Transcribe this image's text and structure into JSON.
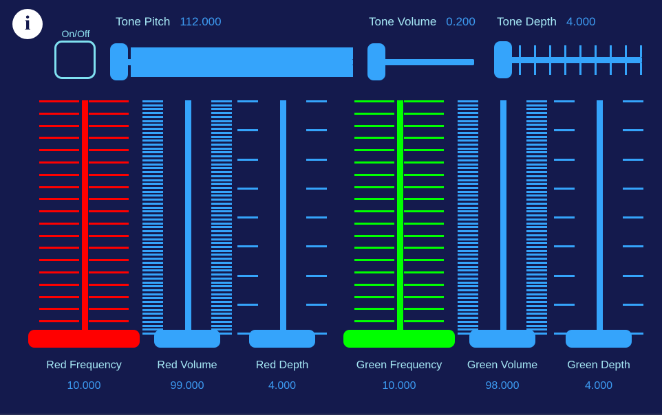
{
  "app": {
    "background": "#141a4d",
    "accent_blue": "#35a4fb",
    "label_color": "#a7e9f6",
    "value_color": "#3d9bf2",
    "red": "#ff0000",
    "green": "#00ff00",
    "cyan_border": "#7fe0f0"
  },
  "info_icon": {
    "glyph": "i",
    "name": "info-icon"
  },
  "onoff": {
    "label": "On/Off",
    "state": "off"
  },
  "top_sliders": [
    {
      "key": "tone_pitch",
      "label": "Tone Pitch",
      "value": "112.000",
      "value_num": 112.0,
      "ticks": 112,
      "knob_position": "start",
      "color": "#35a4fb"
    },
    {
      "key": "tone_volume",
      "label": "Tone Volume",
      "value": "0.200",
      "value_num": 0.2,
      "ticks": 0,
      "knob_position": "start",
      "color": "#35a4fb"
    },
    {
      "key": "tone_depth",
      "label": "Tone Depth",
      "value": "4.000",
      "value_num": 4.0,
      "ticks": 9,
      "knob_position": "start",
      "color": "#35a4fb"
    }
  ],
  "vertical_sliders": [
    {
      "key": "red_frequency",
      "label": "Red Frequency",
      "value": "10.000",
      "value_num": 10.0,
      "ticks": 20,
      "tick_style": "wide",
      "color": "#ff0000",
      "knob_width": "wide"
    },
    {
      "key": "red_volume",
      "label": "Red Volume",
      "value": "99.000",
      "value_num": 99.0,
      "ticks": 60,
      "tick_style": "medium",
      "color": "#35a4fb",
      "knob_width": "medium"
    },
    {
      "key": "red_depth",
      "label": "Red Depth",
      "value": "4.000",
      "value_num": 4.0,
      "ticks": 9,
      "tick_style": "narrow",
      "color": "#35a4fb",
      "knob_width": "narrow"
    },
    {
      "key": "green_frequency",
      "label": "Green Frequency",
      "value": "10.000",
      "value_num": 10.0,
      "ticks": 20,
      "tick_style": "wide",
      "color": "#00ff00",
      "knob_width": "wide"
    },
    {
      "key": "green_volume",
      "label": "Green Volume",
      "value": "98.000",
      "value_num": 98.0,
      "ticks": 60,
      "tick_style": "medium",
      "color": "#35a4fb",
      "knob_width": "medium"
    },
    {
      "key": "green_depth",
      "label": "Green Depth",
      "value": "4.000",
      "value_num": 4.0,
      "ticks": 9,
      "tick_style": "narrow",
      "color": "#35a4fb",
      "knob_width": "narrow"
    }
  ]
}
